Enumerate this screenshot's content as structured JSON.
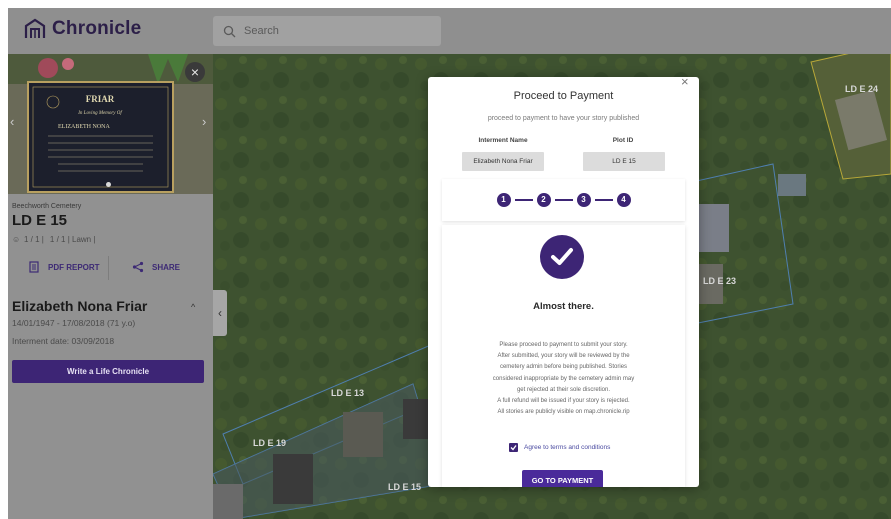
{
  "app": {
    "name": "Chronicle",
    "search_placeholder": "Search"
  },
  "sidebar": {
    "cemetery": "Beechworth Cemetery",
    "plot_id": "LD E 15",
    "plot_meta": "  1 / 1 |   1 / 1 | Lawn |",
    "pdf_label": "PDF REPORT",
    "share_label": "SHARE",
    "person_name": "Elizabeth Nona Friar",
    "dates": "14/01/1947 - 17/08/2018 (71 y.o)",
    "interment": "Interment date: 03/09/2018",
    "write_button": "Write a Life Chronicle",
    "plaque": {
      "surname": "FRIAR",
      "line1": "In Loving Memory Of",
      "name": "ELIZABETH NONA"
    }
  },
  "map": {
    "labels": [
      "LD E 24",
      "LD E 13",
      "LD E 19",
      "LD E 15",
      "LD E 23"
    ]
  },
  "modal": {
    "title": "Proceed to Payment",
    "subtitle": "proceed to payment to have your story published",
    "interment_name_label": "Interment Name",
    "plot_id_label": "Plot ID",
    "interment_name_value": "Elizabeth Nona Friar",
    "plot_id_value": "LD E 15",
    "steps": [
      "1",
      "2",
      "3",
      "4"
    ],
    "heading": "Almost there.",
    "body_lines": [
      "Please proceed to payment to submit your story.",
      "After submitted, your story will be reviewed by the",
      "cemetery admin before being published. Stories",
      "considered inappropriate by the cemetery admin may",
      "get rejected at their sole discretion.",
      "A full refund will be issued if your story is rejected.",
      "All stories are publicly visible on map.chronicle.rip"
    ],
    "terms_label": "Agree to terms and conditions",
    "terms_checked": true,
    "pay_button": "GO TO PAYMENT"
  },
  "colors": {
    "brand": "#3d2575",
    "overlay_grey": "#8f8f8f"
  }
}
